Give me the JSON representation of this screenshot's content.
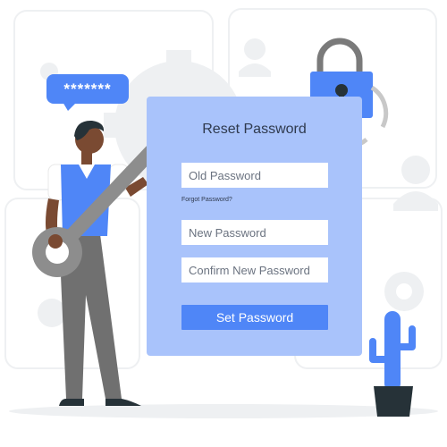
{
  "bubble": {
    "text": "*******"
  },
  "form": {
    "title": "Reset Password",
    "old_password_placeholder": "Old Password",
    "forgot_link": "Forgot Password?",
    "new_password_placeholder": "New Password",
    "confirm_password_placeholder": "Confirm New Password",
    "submit_label": "Set Password"
  },
  "colors": {
    "accent": "#4f86f7",
    "card": "#a9c3fb",
    "background_shapes": "#eef0f2",
    "figure_grey": "#8d8d8d",
    "cactus": "#4f86f7",
    "pot": "#263238"
  },
  "icons": [
    "padlock-icon",
    "refresh-arrows-icon",
    "gear-icon",
    "user-silhouette-icon",
    "key-icon",
    "cactus-icon"
  ]
}
